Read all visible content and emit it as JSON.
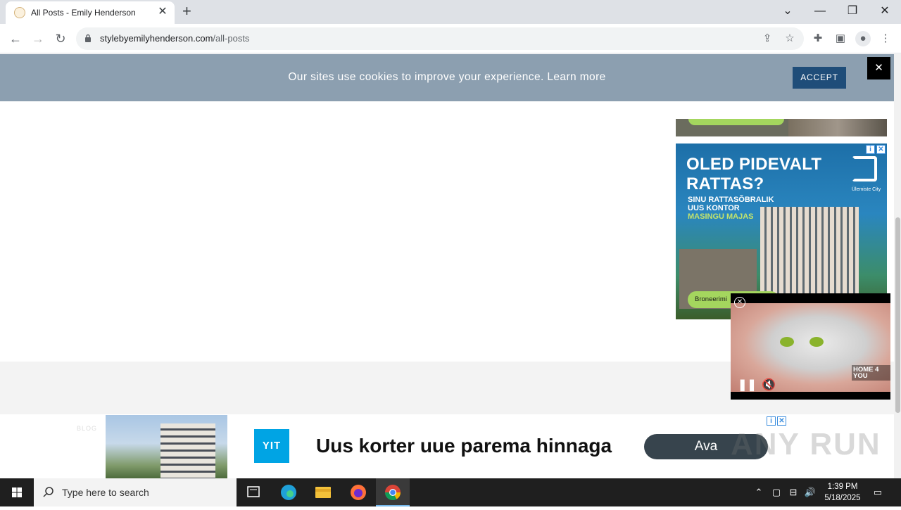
{
  "browser": {
    "tab_title": "All Posts - Emily Henderson",
    "url_domain": "stylebyemilyhenderson.com",
    "url_path": "/all-posts"
  },
  "cookie_banner": {
    "message": "Our sites use cookies to improve your experience. Learn more",
    "accept_label": "ACCEPT",
    "close_label": "✕"
  },
  "side_ad": {
    "headline_line1": "OLED PIDEVALT",
    "headline_line2": "RATTAS?",
    "sub_line1": "SINU RATTASÕBRALIK",
    "sub_line2": "UUS KONTOR",
    "sub_highlight": "MASINGU MAJAS",
    "logo_text": "Ülemiste City",
    "cta": "Broneerimi"
  },
  "video_ad": {
    "brand": "HOME 4 YOU"
  },
  "footer": {
    "faint_text": "BLOG"
  },
  "banner_ad": {
    "brand": "YIT",
    "headline": "Uus korter uue parema hinnaga",
    "cta": "Ava"
  },
  "watermark": "ANY RUN",
  "taskbar": {
    "search_placeholder": "Type here to search",
    "time": "1:39 PM",
    "date": "5/18/2025"
  }
}
